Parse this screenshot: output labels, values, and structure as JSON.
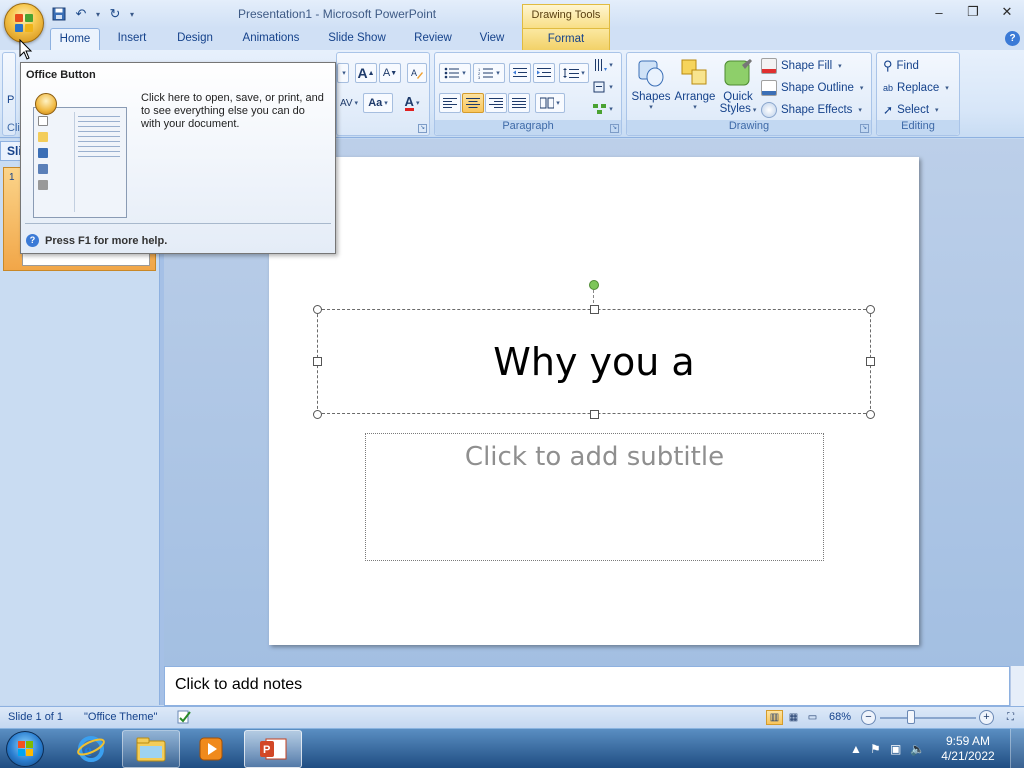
{
  "window": {
    "title": "Presentation1 - Microsoft PowerPoint",
    "context_title": "Drawing Tools",
    "controls": [
      "–",
      "❐",
      "✕"
    ]
  },
  "quick_access": {
    "icons": [
      "save-icon",
      "undo-icon",
      "redo-icon",
      "customize-icon"
    ]
  },
  "tabs": [
    {
      "label": "Home",
      "active": true
    },
    {
      "label": "Insert"
    },
    {
      "label": "Design"
    },
    {
      "label": "Animations"
    },
    {
      "label": "Slide Show"
    },
    {
      "label": "Review"
    },
    {
      "label": "View"
    },
    {
      "label": "Format",
      "contextual": true
    }
  ],
  "ribbon": {
    "groups": {
      "paragraph": "Paragraph",
      "drawing": "Drawing",
      "editing": "Editing"
    },
    "drawing": {
      "shapes": "Shapes",
      "arrange": "Arrange",
      "quick_styles_1": "Quick",
      "quick_styles_2": "Styles",
      "shape_fill": "Shape Fill",
      "shape_outline": "Shape Outline",
      "shape_effects": "Shape Effects"
    },
    "editing": {
      "find": "Find",
      "replace": "Replace",
      "select": "Select"
    },
    "font": {
      "grow": "A",
      "shrink": "A",
      "change_case": "Aa",
      "font_color": "A"
    },
    "partial_labels": {
      "paste_fragment": "P",
      "clipboard_fragment": "Cli",
      "slides_tab_fragment": "Sli"
    }
  },
  "tooltip": {
    "title": "Office Button",
    "body": "Click here to open, save, or print, and to see everything else you can do with your document.",
    "help": "Press F1 for more help."
  },
  "slides_pane": {
    "slide_number": "1"
  },
  "slide": {
    "title": "Why you a",
    "subtitle_placeholder": "Click to add subtitle"
  },
  "notes": {
    "placeholder": "Click to add notes"
  },
  "status": {
    "slide": "Slide 1 of 1",
    "theme": "\"Office Theme\"",
    "zoom": "68%",
    "zoom_level": 0.68
  },
  "taskbar": {
    "time": "9:59 AM",
    "date": "4/21/2022",
    "apps": [
      "internet-explorer-icon",
      "file-explorer-icon",
      "media-player-icon",
      "powerpoint-icon"
    ]
  },
  "colors": {
    "accent": "#15428b",
    "selected_tab_bg": "#ecf3fd",
    "contextual_tab": "#f2d168",
    "slide_bg": "#ffffff",
    "taskbar": "#1f4d82"
  }
}
